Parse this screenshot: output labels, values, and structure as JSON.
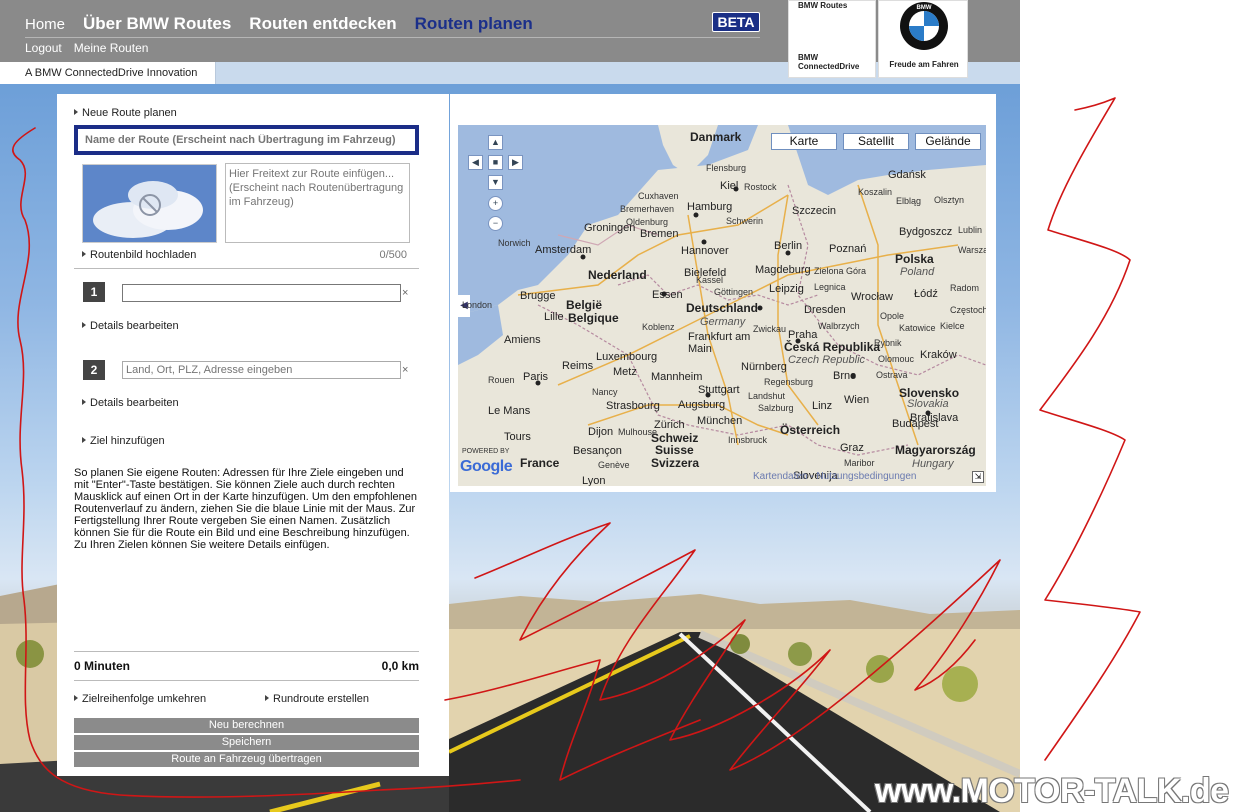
{
  "header": {
    "nav": [
      "Home",
      "Über BMW Routes",
      "Routen entdecken",
      "Routen planen"
    ],
    "subnav": [
      "Logout",
      "Meine Routen"
    ],
    "beta": "BETA",
    "tagline": "A BMW ConnectedDrive Innovation",
    "logo_routes": "BMW Routes",
    "logo_connected": "BMW ConnectedDrive",
    "logo_bmw": "BMW",
    "logo_slogan": "Freude am Fahren"
  },
  "panel": {
    "title": "Neue Route planen",
    "name_placeholder": "Name der Route (Erscheint nach Übertragung im Fahrzeug)",
    "desc_placeholder": "Hier Freitext zur Route einfügen... (Erscheint nach Routenübertragung im Fahrzeug)",
    "upload": "Routenbild hochladen",
    "counter": "0/500",
    "steps": [
      {
        "num": "1",
        "value": "",
        "placeholder": "",
        "clear": "×",
        "details": "Details bearbeiten"
      },
      {
        "num": "2",
        "value": "",
        "placeholder": "Land, Ort, PLZ, Adresse eingeben",
        "clear": "×",
        "details": "Details bearbeiten"
      }
    ],
    "add_goal": "Ziel hinzufügen",
    "help_text": "So planen Sie eigene Routen: Adressen für Ihre Ziele eingeben und mit \"Enter\"-Taste bestätigen. Sie können Ziele auch durch rechten Mausklick auf einen Ort in der Karte hinzufügen. Um den empfohlenen Routenverlauf zu ändern, ziehen Sie die blaue Linie mit der Maus. Zur Fertigstellung Ihrer Route vergeben Sie einen Namen. Zusätzlich können Sie für die Route ein Bild und eine Beschreibung hinzufügen. Zu Ihren Zielen können Sie weitere Details einfügen.",
    "duration": "0 Minuten",
    "distance": "0,0 km",
    "reverse": "Zielreihenfolge umkehren",
    "roundtrip": "Rundroute erstellen",
    "buttons": [
      "Neu berechnen",
      "Speichern",
      "Route an Fahrzeug übertragen"
    ]
  },
  "map": {
    "types": [
      "Karte",
      "Satellit",
      "Gelände"
    ],
    "google": "Google",
    "powered": "POWERED BY",
    "footer": "Kartendaten - Nutzungsbedingungen",
    "countries": [
      "Danmark",
      "Nederland",
      "België",
      "Belgique",
      "Deutschland",
      "Germany",
      "Polska",
      "Poland",
      "Česká Republika",
      "Czech Republic",
      "France",
      "Schweiz",
      "Suisse",
      "Svizzera",
      "Österreich",
      "Slovensko",
      "Slovakia",
      "Magyarország",
      "Hungary",
      "Slovenija"
    ],
    "cities": [
      "Flensburg",
      "Kiel",
      "Rostock",
      "Hamburg",
      "Schwerin",
      "Szczecin",
      "Gdańsk",
      "Koszalin",
      "Elbląg",
      "Olsztyn",
      "Groningen",
      "Bremen",
      "Bydgoszcz",
      "Amsterdam",
      "Hannover",
      "Berlin",
      "Poznań",
      "Bielefeld",
      "Magdeburg",
      "Essen",
      "Leipzig",
      "Wrocław",
      "Łódź",
      "Brugge",
      "Lille",
      "Dresden",
      "Frankfurt am Main",
      "Praha",
      "Opole",
      "Luxembourg",
      "Metz",
      "Mannheim",
      "Nürnberg",
      "Brno",
      "Kraków",
      "Paris",
      "Reims",
      "Stuttgart",
      "Regensburg",
      "Augsburg",
      "Linz",
      "Wien",
      "Strasbourg",
      "München",
      "Bratislava",
      "Budapest",
      "Dijon",
      "Zürich",
      "Innsbruck",
      "Graz",
      "Lyon",
      "Amiens",
      "Rouen",
      "Le Mans",
      "Tours",
      "Besançon",
      "Genève",
      "Maribor",
      "Norwich",
      "London",
      "Cuxhaven",
      "Bremerhaven",
      "Oldenburg",
      "Göttingen",
      "Kassel",
      "Koblenz",
      "Zwickau",
      "Olomouc",
      "Katowice",
      "Rybnik",
      "Radom",
      "Kielce",
      "Częstochowa",
      "Legnica",
      "Zielona Góra",
      "Walbrzych",
      "Salzburg",
      "Nancy",
      "Mulhouse",
      "Landshut",
      "Ostrava",
      "Lublin",
      "Warszawa"
    ],
    "nav_controls": [
      "▲",
      "◀",
      "■",
      "▶",
      "▼",
      "+",
      "−"
    ]
  },
  "watermark": "www.MOTOR-TALK.de"
}
